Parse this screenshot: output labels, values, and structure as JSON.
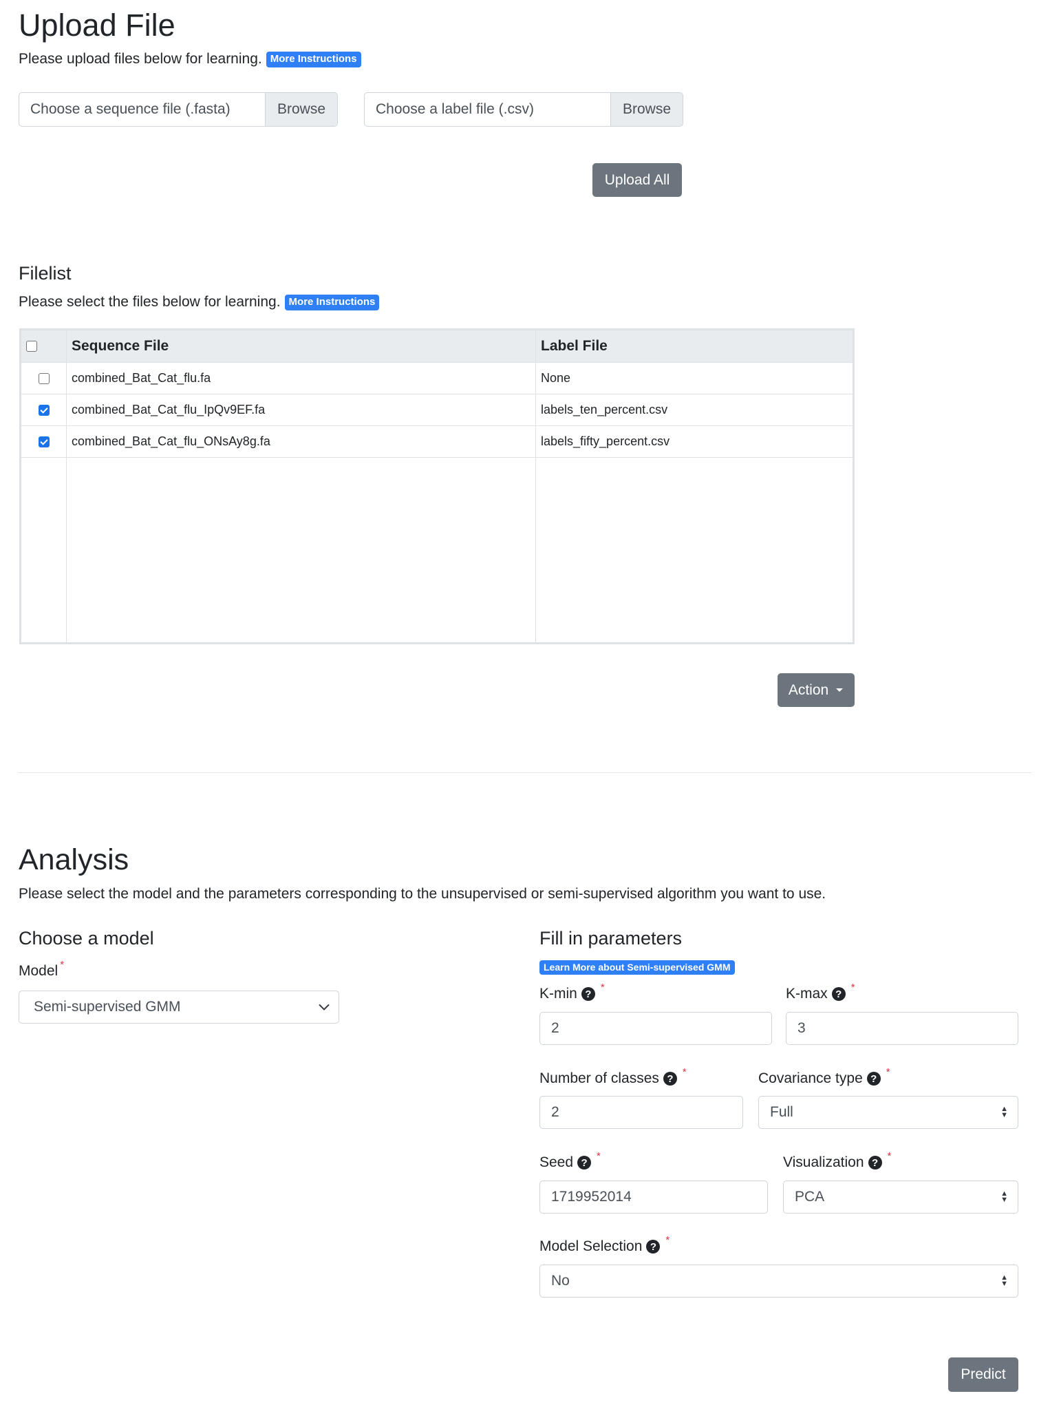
{
  "upload": {
    "title": "Upload File",
    "lead": "Please upload files below for learning.",
    "badge": "More Instructions",
    "sequence_placeholder": "Choose a sequence file (.fasta)",
    "label_placeholder": "Choose a label file (.csv)",
    "browse_label": "Browse",
    "upload_all_label": "Upload All"
  },
  "filelist": {
    "title": "Filelist",
    "lead": "Please select the files below for learning.",
    "badge": "More Instructions",
    "headers": {
      "sequence": "Sequence File",
      "label": "Label File"
    },
    "rows": [
      {
        "checked": false,
        "sequence": "combined_Bat_Cat_flu.fa",
        "label": "None"
      },
      {
        "checked": true,
        "sequence": "combined_Bat_Cat_flu_IpQv9EF.fa",
        "label": "labels_ten_percent.csv"
      },
      {
        "checked": true,
        "sequence": "combined_Bat_Cat_flu_ONsAy8g.fa",
        "label": "labels_fifty_percent.csv"
      }
    ],
    "action_label": "Action"
  },
  "analysis": {
    "title": "Analysis",
    "lead": "Please select the model and the parameters corresponding to the unsupervised or semi-supervised algorithm you want to use.",
    "model_section_title": "Choose a model",
    "model_label": "Model",
    "model_value": "Semi-supervised GMM",
    "params_title": "Fill in parameters",
    "learn_more_badge": "Learn More about Semi-supervised GMM",
    "kmin": {
      "label": "K-min",
      "value": "2"
    },
    "kmax": {
      "label": "K-max",
      "value": "3"
    },
    "num_classes": {
      "label": "Number of classes",
      "value": "2"
    },
    "covariance": {
      "label": "Covariance type",
      "value": "Full"
    },
    "seed": {
      "label": "Seed",
      "value": "1719952014"
    },
    "visualization": {
      "label": "Visualization",
      "value": "PCA"
    },
    "model_selection": {
      "label": "Model Selection",
      "value": "No"
    },
    "required_mark": "*",
    "help_glyph": "?",
    "predict_label": "Predict"
  },
  "colors": {
    "badge": "#2f7ff6",
    "secondary_button": "#6c757d",
    "required": "#dc3545",
    "checkbox_checked": "#1a73e8"
  }
}
